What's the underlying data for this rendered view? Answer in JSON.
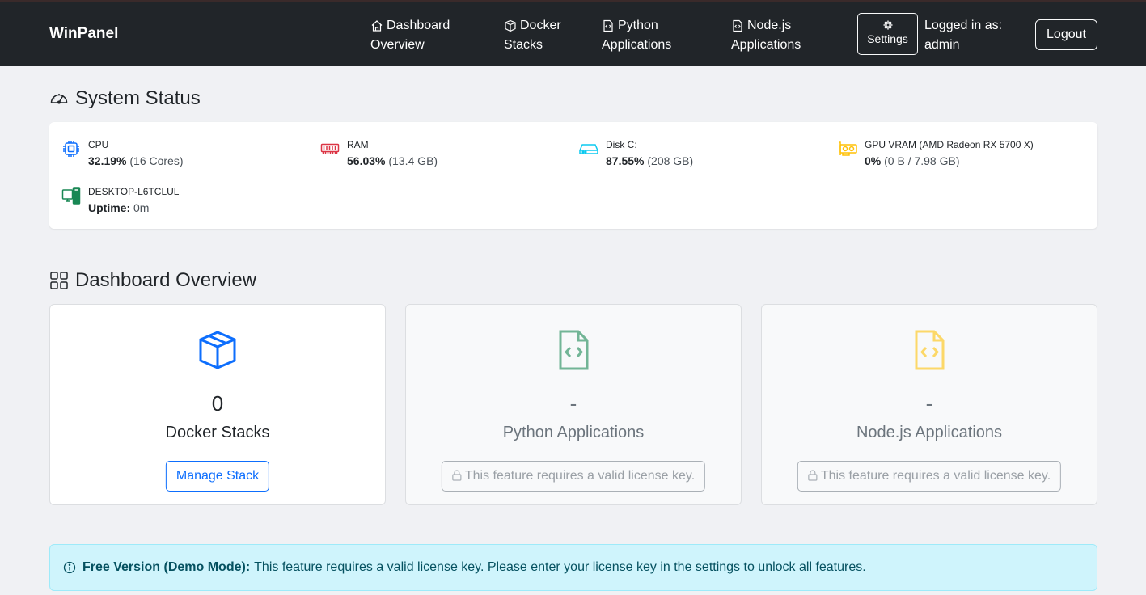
{
  "navbar": {
    "brand": "WinPanel",
    "links": [
      {
        "label_line1": "Dashboard",
        "label_line2": "Overview",
        "icon": "house-icon"
      },
      {
        "label_line1": "Docker",
        "label_line2": "Stacks",
        "icon": "box-icon"
      },
      {
        "label_line1": "Python",
        "label_line2": "Applications",
        "icon": "file-code-icon"
      },
      {
        "label_line1": "Node.js",
        "label_line2": "Applications",
        "icon": "file-code-icon"
      }
    ],
    "settings_label": "Settings",
    "logged_in_label": "Logged in as:",
    "username": "admin",
    "logout_label": "Logout"
  },
  "system_status": {
    "heading": "System Status",
    "cpu": {
      "label": "CPU",
      "value": "32.19%",
      "detail": "(16 Cores)"
    },
    "ram": {
      "label": "RAM",
      "value": "56.03%",
      "detail": "(13.4 GB)"
    },
    "disk": {
      "label": "Disk C:",
      "value": "87.55%",
      "detail": "(208 GB)"
    },
    "gpu": {
      "label": "GPU VRAM (AMD Radeon RX 5700 X)",
      "value": "0%",
      "detail": "(0 B / 7.98 GB)"
    },
    "host": {
      "label": "DESKTOP-L6TCLUL",
      "value_label": "Uptime:",
      "detail": "0m"
    }
  },
  "dashboard": {
    "heading": "Dashboard Overview",
    "cards": [
      {
        "count": "0",
        "title": "Docker Stacks",
        "button": "Manage Stack"
      },
      {
        "count": "-",
        "title": "Python Applications",
        "button": "This feature requires a valid license key."
      },
      {
        "count": "-",
        "title": "Node.js Applications",
        "button": "This feature requires a valid license key."
      }
    ]
  },
  "alert": {
    "bold": "Free Version (Demo Mode):",
    "text": "This feature requires a valid license key. Please enter your license key in the settings to unlock all features."
  },
  "colors": {
    "navbar_bg": "#212529",
    "primary": "#0d6efd",
    "cpu": "#0d6efd",
    "ram": "#dc3545",
    "disk": "#0dcaf0",
    "gpu": "#ffc107",
    "host": "#198754",
    "python_icon": "#198754",
    "node_icon": "#ffc107",
    "alert_bg": "#cff4fc"
  }
}
